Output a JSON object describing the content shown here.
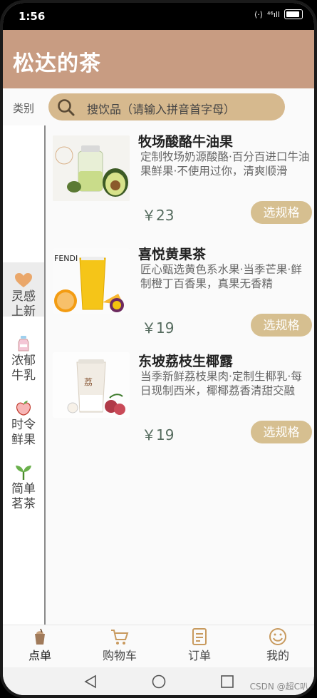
{
  "status": {
    "time": "1:56",
    "net": "⁴⁶ıll"
  },
  "app": {
    "title": "松达的茶"
  },
  "search": {
    "category_label": "类别",
    "placeholder": "搜饮品（请输入拼音首字母）"
  },
  "categories": [
    {
      "label_1": "灵感",
      "label_2": "上新",
      "icon": "heart-icon",
      "active": true
    },
    {
      "label_1": "浓郁",
      "label_2": "牛乳",
      "icon": "milk-bottle-icon"
    },
    {
      "label_1": "时令",
      "label_2": "鲜果",
      "icon": "peach-icon"
    },
    {
      "label_1": "简单",
      "label_2": "茗茶",
      "icon": "sprout-icon"
    }
  ],
  "products": [
    {
      "name": "牧场酸酪牛油果",
      "desc": "定制牧场奶源酸酪·百分百进口牛油果鲜果·不使用过你，清爽顺滑",
      "price": "￥23",
      "button": "选规格"
    },
    {
      "name": "喜悦黄果茶",
      "desc": "匠心甄选黄色系水果·当季芒果·鲜制橙丁百香果，真果无香精",
      "price": "￥19",
      "button": "选规格"
    },
    {
      "name": "东坡荔枝生椰露",
      "desc": "当季新鲜荔枝果肉·定制生椰乳·每日现制西米，椰椰荔香清甜交融",
      "price": "￥19",
      "button": "选规格"
    }
  ],
  "tabs": [
    {
      "label": "点单",
      "icon": "drink-cup-icon",
      "active": true
    },
    {
      "label": "购物车",
      "icon": "cart-icon"
    },
    {
      "label": "订单",
      "icon": "order-list-icon"
    },
    {
      "label": "我的",
      "icon": "smiley-icon"
    }
  ],
  "watermark": "CSDN @超C叭",
  "colors": {
    "header": "#c89c82",
    "search": "#d6b98e",
    "button": "#d6bf90",
    "price": "#556b5e"
  }
}
